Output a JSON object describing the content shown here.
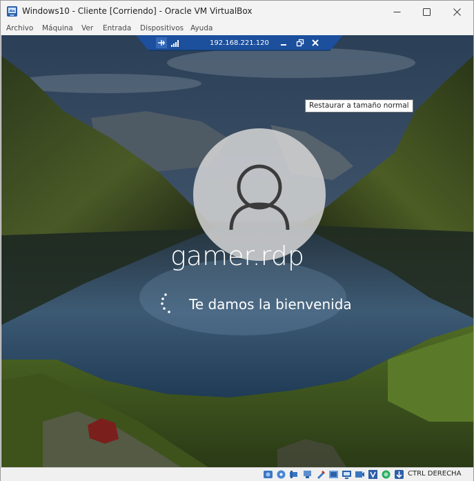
{
  "window": {
    "title": "Windows10 - Cliente [Corriendo] - Oracle VM VirtualBox",
    "icon": "virtualbox-icon"
  },
  "menu": {
    "items": [
      "Archivo",
      "Máquina",
      "Ver",
      "Entrada",
      "Dispositivos",
      "Ayuda"
    ]
  },
  "mini_toolbar": {
    "ip": "192.168.221.120",
    "icons": [
      "pin-icon",
      "signal-icon",
      "minimize-icon",
      "restore-icon",
      "close-icon"
    ]
  },
  "tooltip": {
    "text": "Restaurar a tamaño normal"
  },
  "login": {
    "username": "gamer.rdp",
    "status": "Te damos la bienvenida"
  },
  "statusbar": {
    "host_key": "CTRL DERECHA",
    "icons": [
      "hard-disk-icon",
      "optical-drive-icon",
      "audio-icon",
      "network-icon",
      "usb-icon",
      "shared-folders-icon",
      "display-icon",
      "recording-icon",
      "vt-x-icon",
      "guest-additions-icon",
      "mouse-integration-icon"
    ]
  },
  "colors": {
    "toolbar_blue": "#1c4f9c",
    "tooltip_border": "#767676"
  }
}
